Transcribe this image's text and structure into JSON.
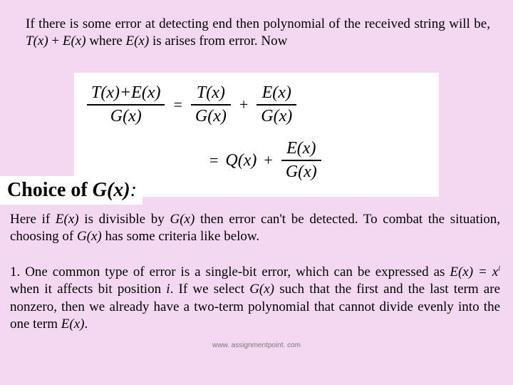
{
  "para1": {
    "t1": "If there is some error at detecting end then polynomial of the received string will be, ",
    "tx": "T(x)",
    "plus": " + ",
    "ex": "E(x)",
    "where": " where ",
    "ex2": "E(x)",
    "t2": " is arises from error. Now"
  },
  "equation": {
    "r1": {
      "f1n": "T(x)+E(x)",
      "f1d": "G(x)",
      "eq": "=",
      "f2n": "T(x)",
      "f2d": "G(x)",
      "plus": "+",
      "f3n": "E(x)",
      "f3d": "G(x)"
    },
    "r2": {
      "eq": "=",
      "q": "Q(x)",
      "plus": "+",
      "f1n": "E(x)",
      "f1d": "G(x)"
    }
  },
  "heading": {
    "pre": "Choice of ",
    "gx": "G(x)",
    "colon": ":"
  },
  "para2": {
    "t1": "Here if ",
    "ex": "E(x)",
    "t2": " is divisible by ",
    "gx": "G(x)",
    "t3": " then error can't be detected. To combat the situation, choosing of ",
    "gx2": "G(x)",
    "t4": " has some criteria like below."
  },
  "para3": {
    "lead": " 1. One common type of error is a single-bit error, which can be expressed as ",
    "ex": "E(x) = x",
    "exp": "i",
    "t2": " when it affects bit position ",
    "ivar": "i",
    "t3": ". If we select ",
    "gx": "G(x)",
    "t4": " such that the first and the last term are nonzero, then we already have a two-term polynomial that cannot divide evenly into the one term ",
    "ex2": "E(x)",
    "t5": "."
  },
  "footer": "www. assignmentpoint. com"
}
